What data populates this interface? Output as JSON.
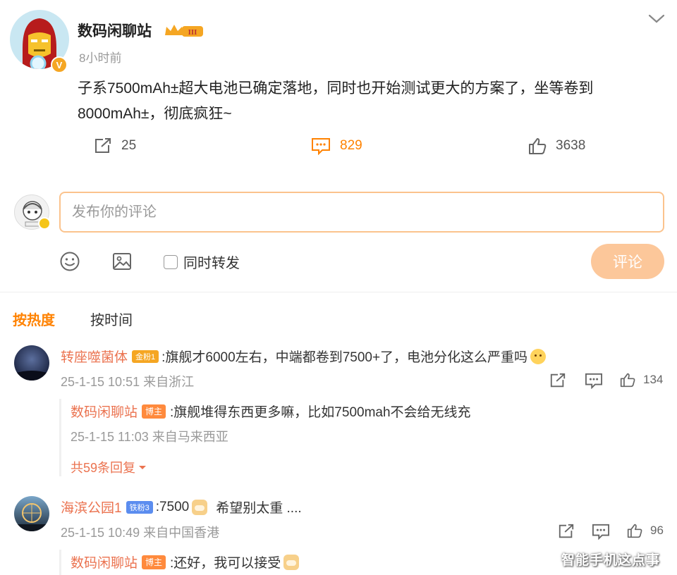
{
  "post": {
    "author": "数码闲聊站",
    "time": "8小时前",
    "text": "子系7500mAh±超大电池已确定落地，同时也开始测试更大的方案了，坐等卷到8000mAh±，彻底疯狂~",
    "verified_badge": "V",
    "level_badge": "III",
    "reposts": "25",
    "comments": "829",
    "likes": "3638"
  },
  "compose": {
    "placeholder": "发布你的评论",
    "also_repost": "同时转发",
    "submit": "评论"
  },
  "sort": {
    "hot": "按热度",
    "time": "按时间"
  },
  "comments": [
    {
      "name": "转座噬菌体",
      "badge": "金粉1",
      "text": ":旗舰才6000左右，中端都卷到7500+了，电池分化这么严重吗",
      "meta": "25-1-15 10:51 来自浙江",
      "likes": "134",
      "reply": {
        "name": "数码闲聊站",
        "badge": "博主",
        "text": ":旗舰堆得东西更多嘛，比如7500mah不会给无线充",
        "meta": "25-1-15 11:03 来自马来西亚"
      },
      "more_replies": "共59条回复"
    },
    {
      "name": "海滨公园1",
      "badge": "铁粉3",
      "text_a": ":7500",
      "text_b": "希望别太重 ....",
      "meta": "25-1-15 10:49 来自中国香港",
      "likes": "96",
      "reply": {
        "name": "数码闲聊站",
        "badge": "博主",
        "text": ":还好，我可以接受"
      }
    }
  ],
  "watermark": "智能手机这点事",
  "colors": {
    "accent": "#ff8200",
    "name": "#eb7350",
    "submit_disabled": "#fcc79a"
  }
}
